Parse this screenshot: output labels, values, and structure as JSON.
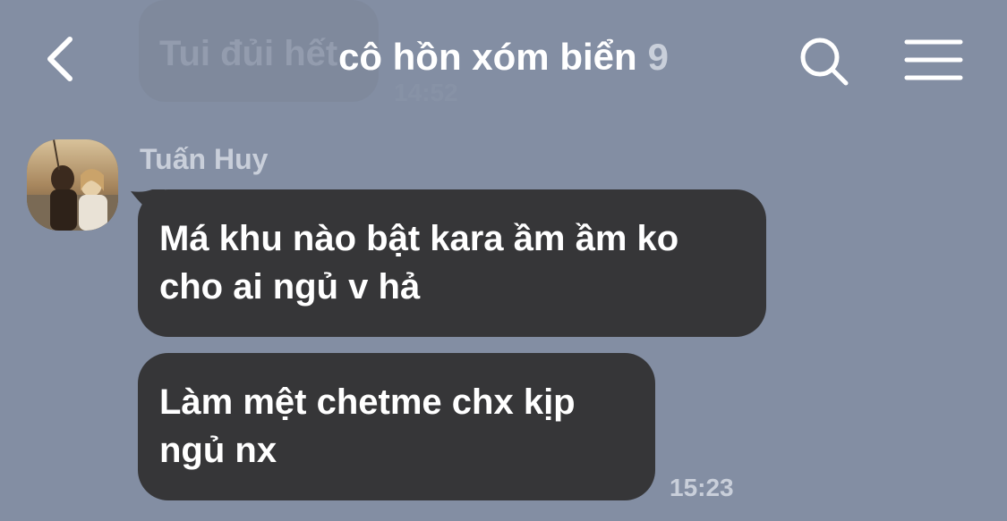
{
  "header": {
    "back_icon": "chevron-left-icon",
    "title": "cô hồn xóm biển",
    "member_count": "9",
    "search_icon": "search-icon",
    "menu_icon": "hamburger-menu-icon"
  },
  "previous_message": {
    "text": "Tui đủi hết",
    "time": "14:52"
  },
  "conversation": {
    "sender_name": "Tuấn Huy",
    "messages": [
      {
        "text": "Má khu nào bật kara ầm ầm ko\ncho ai ngủ v hả"
      },
      {
        "text": "Làm mệt chetme chx kịp\nngủ nx"
      }
    ],
    "last_time": "15:23"
  },
  "colors": {
    "background": "#838ea3",
    "bubble": "#363638",
    "text_primary": "#ffffff",
    "text_muted": "#c9cfda"
  }
}
